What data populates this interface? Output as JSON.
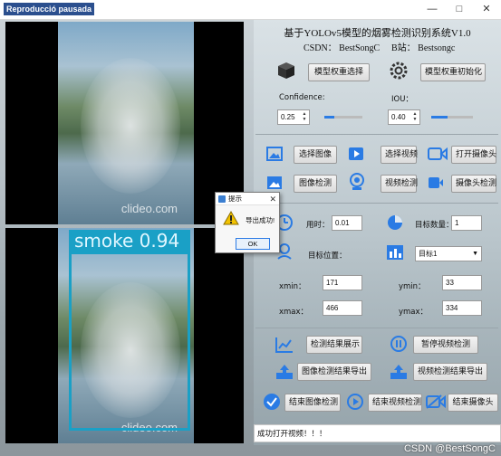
{
  "window": {
    "title_badge": "Reproducció pausada",
    "title_sub": "基于YOLOv5模型的烟雾检测识别系统",
    "controls": [
      "—",
      "□",
      "✕"
    ]
  },
  "video": {
    "watermark": "clideo.com",
    "detection_label": "smoke 0.94"
  },
  "header": {
    "title": "基于YOLOv5模型的烟雾检测识别系统V1.0",
    "csdn": "CSDN： BestSongC",
    "bilibili": "B站： Bestsongc"
  },
  "model": {
    "select_weights": "模型权重选择",
    "init_weights": "模型权重初始化",
    "confidence_label": "Confidence:",
    "confidence_value": "0.25",
    "iou_label": "IOU：",
    "iou_value": "0.40",
    "confidence_slider_fraction": 0.25,
    "iou_slider_fraction": 0.4
  },
  "input": {
    "select_image": "选择图像",
    "select_video": "选择视频",
    "open_camera": "打开摄像头",
    "image_detect": "图像检测",
    "video_detect": "视频检测",
    "camera_detect": "摄像头检测"
  },
  "stats": {
    "time_label": "用时：",
    "time_value": "0.01",
    "count_label": "目标数量：",
    "count_value": "1",
    "position_label": "目标位置：",
    "target_select": "目标1",
    "xmin_label": "xmin：",
    "xmin_value": "171",
    "ymin_label": "ymin：",
    "ymin_value": "33",
    "xmax_label": "xmax：",
    "xmax_value": "466",
    "ymax_label": "ymax：",
    "ymax_value": "334"
  },
  "actions": {
    "show_results": "检测结果展示",
    "pause_video": "暂停视频检测",
    "export_image": "图像检测结果导出",
    "export_video": "视频检测结果导出",
    "end_image": "结束图像检测",
    "end_video": "结束视频检测",
    "end_camera": "结束摄像头"
  },
  "status": {
    "message": "成功打开视频！！！",
    "credit": "CSDN @BestSongC"
  },
  "dialog": {
    "title": "提示",
    "close": "✕",
    "message": "导出成功!",
    "ok": "OK"
  },
  "colors": {
    "accent_blue": "#1aa0c6",
    "icon_blue": "#2a7be4"
  }
}
